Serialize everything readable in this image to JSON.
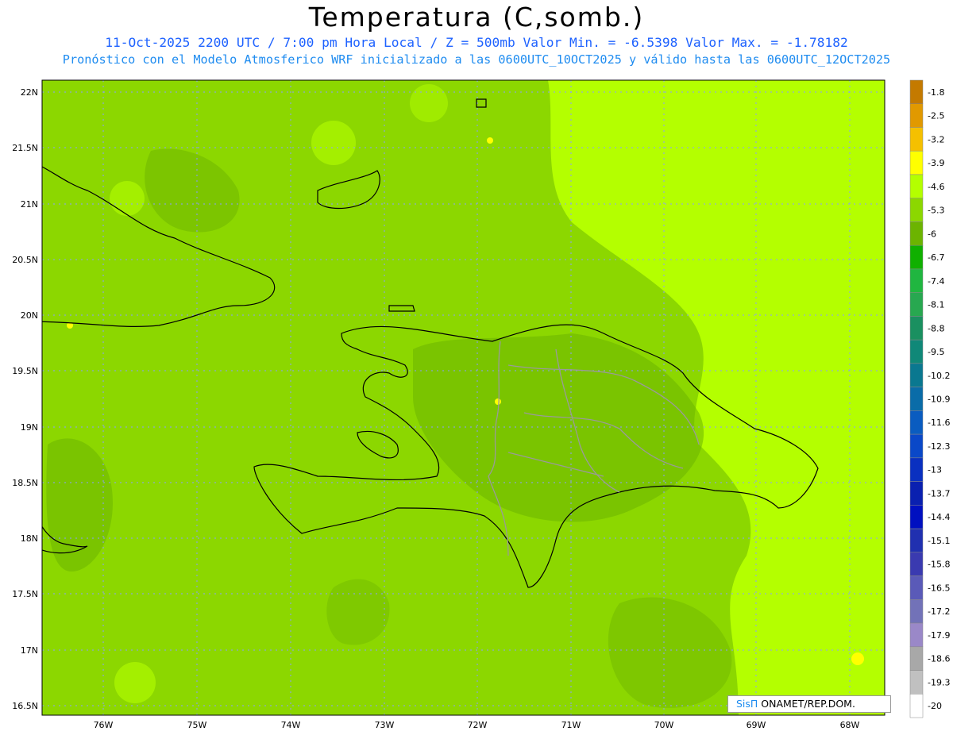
{
  "header": {
    "title": "Temperatura (C,somb.)",
    "subtitle_line1": "11-Oct-2025  2200 UTC / 7:00 pm Hora Local / Z = 500mb  Valor Min. = -6.5398  Valor Max. = -1.78182",
    "subtitle_line2": "Pronóstico con el Modelo Atmosferico WRF inicializado a las 0600UTC_10OCT2025 y válido hasta las  0600UTC_12OCT2025"
  },
  "map": {
    "lat_labels": [
      "22N",
      "21.5N",
      "21N",
      "20.5N",
      "20N",
      "19.5N",
      "19N",
      "18.5N",
      "18N",
      "17.5N",
      "17N",
      "16.5N"
    ],
    "lon_labels": [
      "76W",
      "75W",
      "74W",
      "73W",
      "72W",
      "71W",
      "70W",
      "69W",
      "68W"
    ]
  },
  "colorbar": {
    "labels": [
      "-1.8",
      "-2.5",
      "-3.2",
      "-3.9",
      "-4.6",
      "-5.3",
      "-6",
      "-6.7",
      "-7.4",
      "-8.1",
      "-8.8",
      "-9.5",
      "-10.2",
      "-10.9",
      "-11.6",
      "-12.3",
      "-13",
      "-13.7",
      "-14.4",
      "-15.1",
      "-15.8",
      "-16.5",
      "-17.2",
      "-17.9",
      "-18.6",
      "-19.3",
      "-20"
    ],
    "colors": [
      "#c47a00",
      "#e19900",
      "#f5c000",
      "#ffff00",
      "#b4ff00",
      "#8cd700",
      "#6cb400",
      "#10b000",
      "#20b640",
      "#28a850",
      "#1a9060",
      "#108878",
      "#0a7890",
      "#0a6ca8",
      "#0a5cc0",
      "#0a48c8",
      "#0a30c0",
      "#0a20b0",
      "#0010c0",
      "#2030b0",
      "#3a3ab0",
      "#5a5ab8",
      "#7272b8",
      "#9a88c8",
      "#a8a8a8",
      "#c0c0c0",
      "#ffffff"
    ]
  },
  "credit": {
    "brand": "SisΠ",
    "text": " ONAMET/REP.DOM."
  }
}
